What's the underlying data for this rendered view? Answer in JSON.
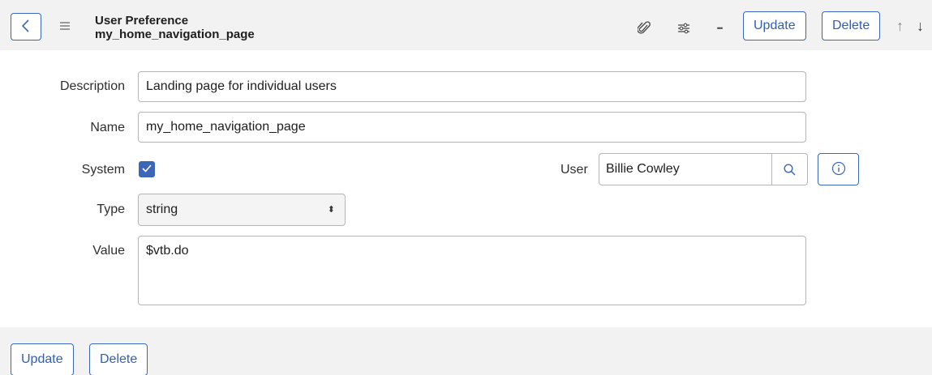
{
  "header": {
    "title": "User Preference",
    "subtitle": "my_home_navigation_page",
    "back_icon": "chevron-left-icon",
    "menu_icon": "hamburger-icon",
    "attachment_icon": "paperclip-icon",
    "personalize_icon": "sliders-icon",
    "more_icon": "more-horizontal-icon",
    "more_glyph": "•••",
    "update_label": "Update",
    "delete_label": "Delete",
    "prev_glyph": "↑",
    "next_glyph": "↓"
  },
  "form": {
    "description": {
      "label": "Description",
      "value": "Landing page for individual users"
    },
    "name": {
      "label": "Name",
      "value": "my_home_navigation_page"
    },
    "system": {
      "label": "System",
      "checked": true
    },
    "user": {
      "label": "User",
      "value": "Billie Cowley",
      "search_icon": "search-icon",
      "info_icon": "info-icon"
    },
    "type": {
      "label": "Type",
      "value": "string",
      "caret": "⬍"
    },
    "value": {
      "label": "Value",
      "value": "$vtb.do"
    }
  },
  "footer": {
    "update_label": "Update",
    "delete_label": "Delete"
  },
  "colors": {
    "accent": "#3c67b8",
    "header_bg": "#f2f2f3",
    "border": "#b5b5b5"
  }
}
